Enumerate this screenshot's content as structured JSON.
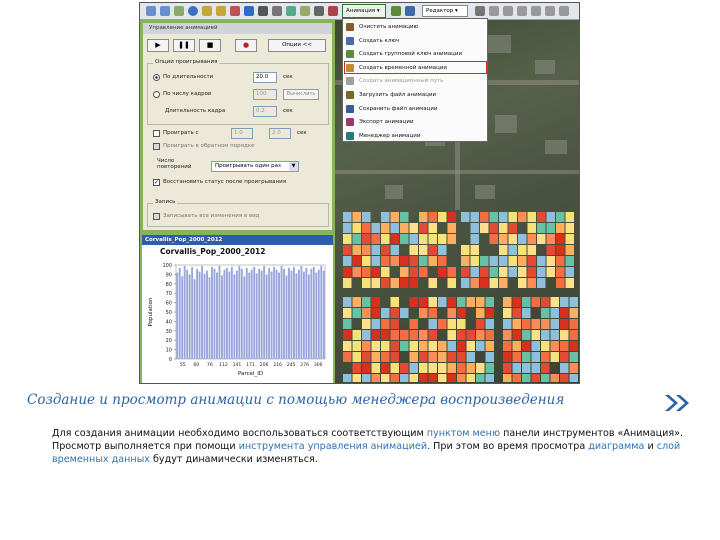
{
  "toolbar": {
    "animation_button": "Анимация ▾",
    "zoom_value": "Редактор ▾"
  },
  "dialog": {
    "title": "Управление анимацией",
    "play_buttons": [
      "▶",
      "❚❚",
      "■",
      "●"
    ],
    "options_button": "Опции <<",
    "group_playback": "Опции проигрывания",
    "radio_duration": "По длительности",
    "duration_value": "20.0",
    "duration_unit": "сек",
    "radio_frames": "По числу кадров",
    "frames_value": "100",
    "frames_btn": "Вычислить",
    "frame_length_label": "Длительность кадра",
    "frame_length_value": "0.2",
    "frame_length_unit": "сек",
    "checkbox_play_range": "Проиграть с",
    "range_from": "1.0",
    "range_to": "2.0",
    "range_unit": "сек",
    "checkbox_reverse": "Проиграть в обратном порядке",
    "when_label": "Число\nповторений",
    "select_value": "Проигрывать один раз",
    "checkbox_restore": "Восстановить статус после проигрывания",
    "group_record": "Запись",
    "checkbox_record": "Записывать все изменения в вид"
  },
  "menu": {
    "items": [
      {
        "label": "Очистить анимацию",
        "dim": false,
        "icon_color": "#8a5a2a"
      },
      {
        "label": "Создать ключ",
        "dim": false,
        "icon_color": "#4a6aa8"
      },
      {
        "label": "Создать групповой ключ анимации",
        "dim": false,
        "icon_color": "#5d8b3a"
      },
      {
        "label": "Создать временной анимации",
        "dim": false,
        "icon_color": "#c48a2e"
      },
      {
        "label": "Создать анимационный путь",
        "dim": true,
        "icon_color": "#a0a0a0"
      },
      {
        "label": "Загрузить файл анимации",
        "dim": false,
        "icon_color": "#7a6a2a"
      },
      {
        "label": "Сохранить файл анимации",
        "dim": false,
        "icon_color": "#3a5a9a"
      },
      {
        "label": "Экспорт анимации",
        "dim": false,
        "icon_color": "#9a3a6a"
      },
      {
        "label": "Менеджер анимации",
        "dim": false,
        "icon_color": "#2a7a7a"
      }
    ]
  },
  "graph": {
    "window_title": "Corvallis_Pop_2000_2012",
    "heading": "Corvallis_Pop_2000_2012"
  },
  "chart_data": {
    "type": "bar",
    "title": "Corvallis_Pop_2000_2012",
    "xlabel": "Parcel_ID",
    "ylabel": "Population",
    "ylim": [
      0,
      100
    ],
    "yticks": [
      0,
      10,
      20,
      30,
      40,
      50,
      60,
      70,
      80,
      90,
      100
    ],
    "xticks": [
      "55",
      "60",
      "76",
      "112",
      "141",
      "171",
      "206",
      "216",
      "245",
      "276",
      "306"
    ],
    "values": [
      92,
      97,
      88,
      99,
      95,
      90,
      98,
      85,
      96,
      93,
      99,
      91,
      94,
      87,
      98,
      96,
      92,
      99,
      89,
      95,
      97,
      93,
      98,
      90,
      94,
      99,
      96,
      88,
      97,
      92,
      95,
      98,
      91,
      96,
      94,
      99,
      90,
      97,
      93,
      98,
      95,
      92,
      99,
      96,
      89,
      97,
      94,
      98,
      91,
      95,
      99,
      93,
      97,
      90,
      96,
      98,
      92,
      95,
      99,
      94
    ]
  },
  "caption": "Создание и просмотр анимации с помощью менеджера воспроизведения",
  "body": {
    "t1": "Для создания анимации необходимо воспользоваться соответствующим ",
    "h1": "пунктом меню",
    "t2": " панели инструментов «Анимация». Просмотр выполняется при помощи ",
    "h2": "инструмента управления анимацией",
    "t3": ". При этом во время просмотра ",
    "h3": "диаграмма",
    "t4": " и ",
    "h4": "слой временных данных",
    "t5": " будут динамически изменяться."
  },
  "colors": {
    "accent_blue": "#2c62a6",
    "highlight_red": "#d02a2a",
    "bar_fill": "#9aa6dc"
  }
}
